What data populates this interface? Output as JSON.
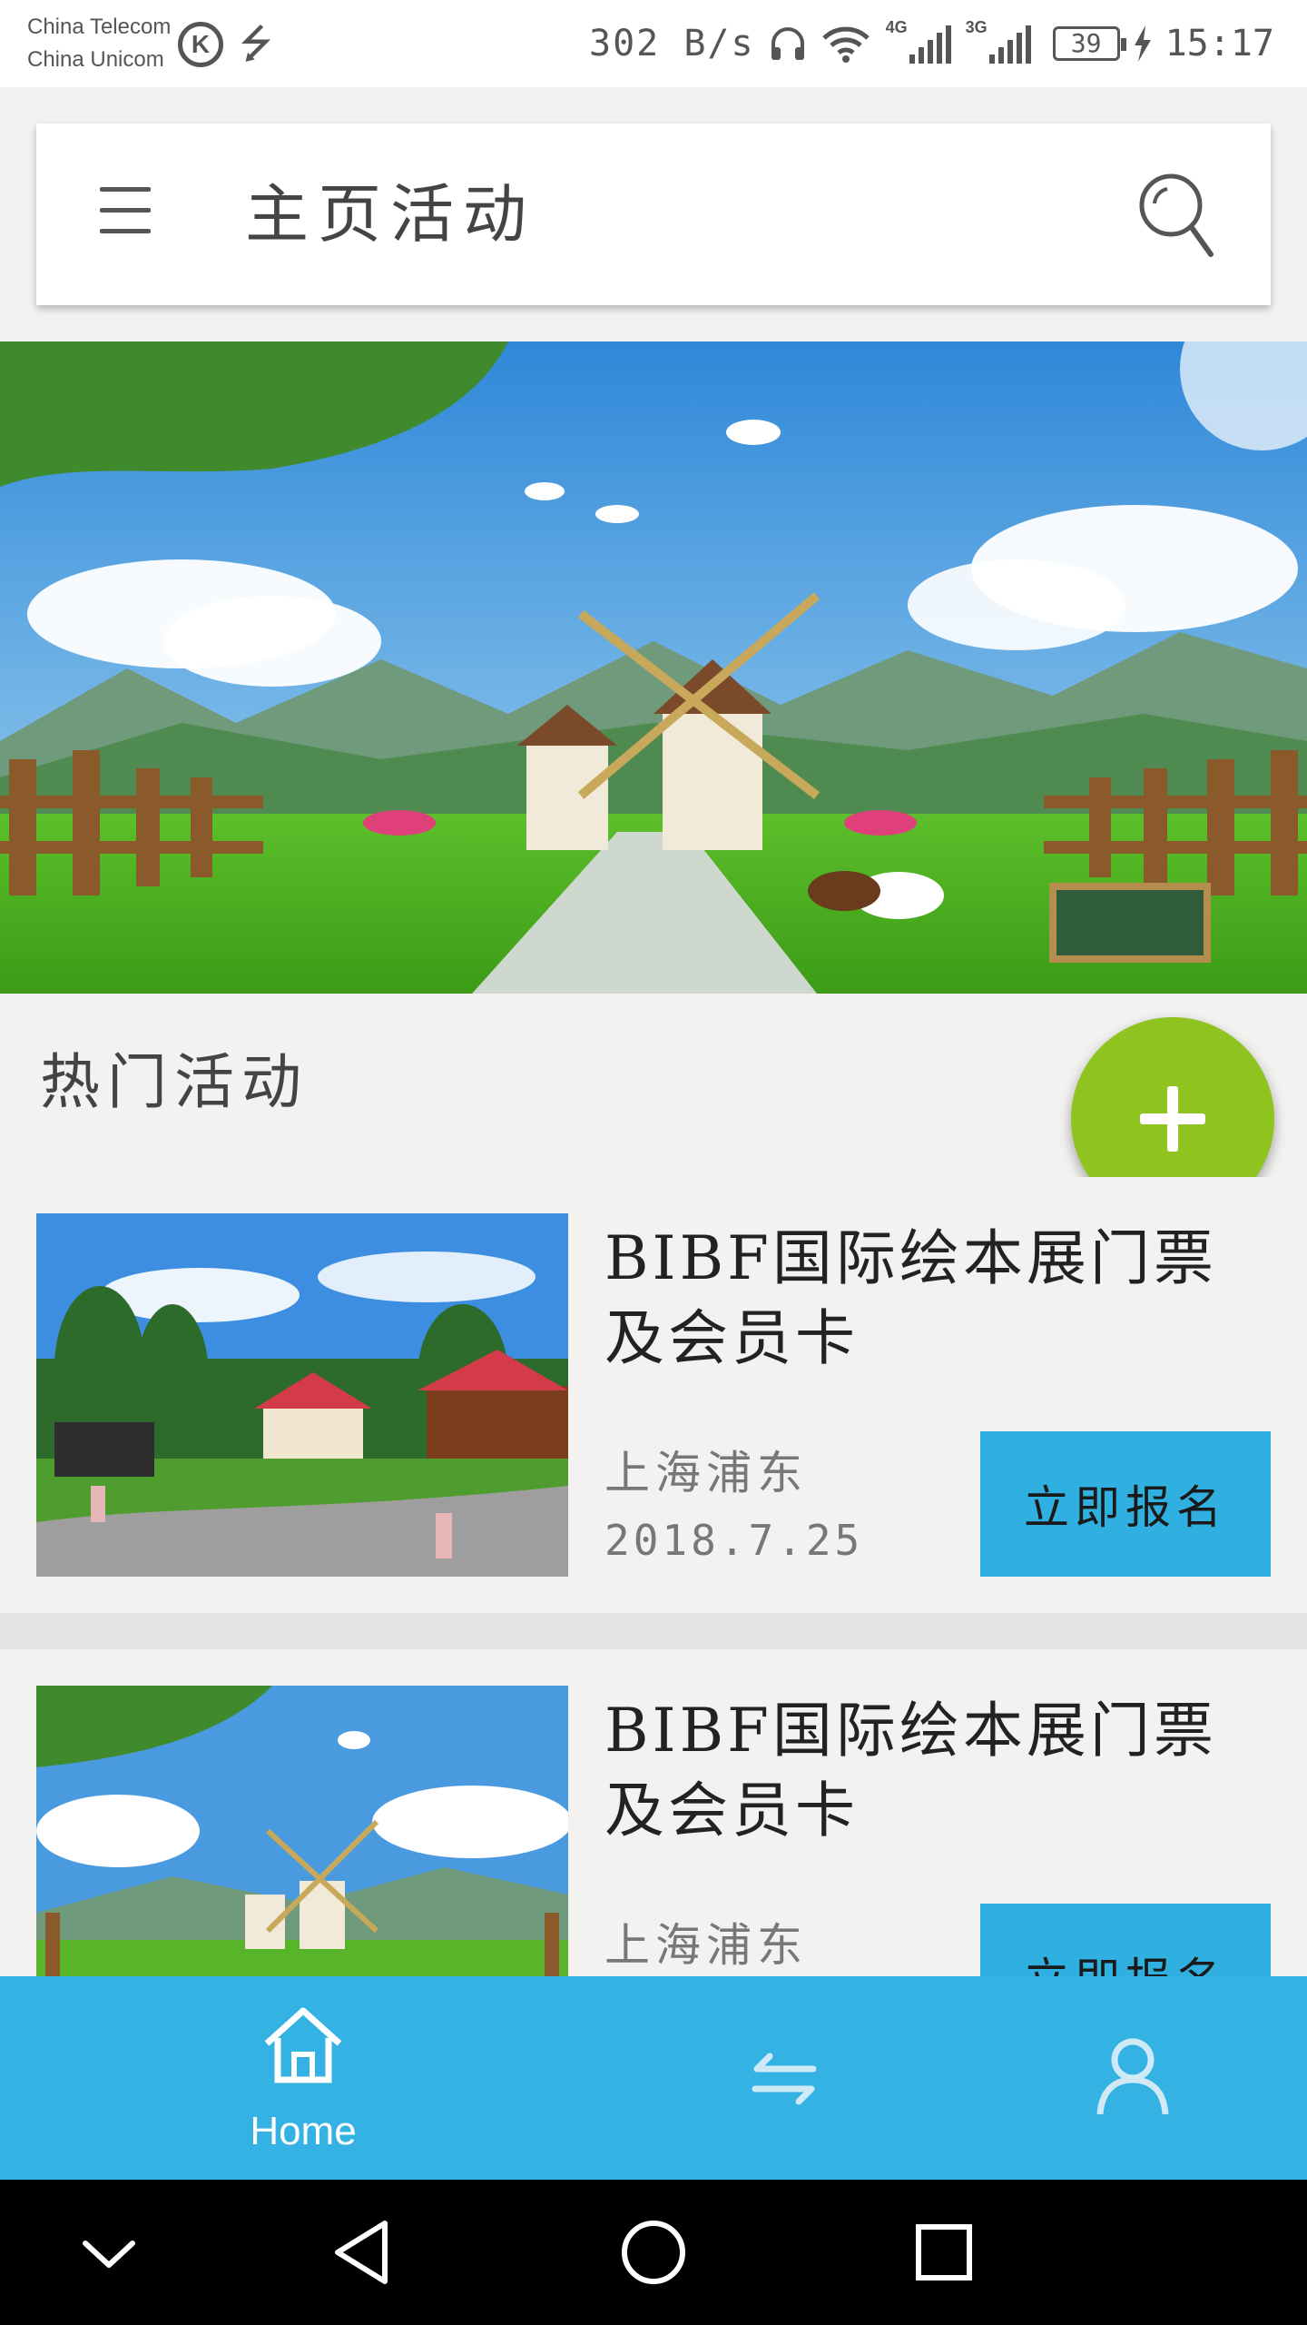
{
  "status_bar": {
    "carrier_1": "China Telecom",
    "carrier_2": "China Unicom",
    "speed": "302 B/s",
    "signal_tag_1": "4G",
    "signal_tag_2": "3G",
    "battery": "39",
    "time": "15:17"
  },
  "app_bar": {
    "title": "主页活动",
    "menu_icon": "hamburger-menu-icon",
    "search_icon": "search-icon"
  },
  "section": {
    "title": "热门活动"
  },
  "activities": [
    {
      "title": "BIBF国际绘本展门票及会员卡",
      "location": "上海浦东",
      "date": "2018.7.25",
      "button": "立即报名"
    },
    {
      "title": "BIBF国际绘本展门票及会员卡",
      "location": "上海浦东",
      "button": "立即报名"
    }
  ],
  "bottom_nav": {
    "home_label": "Home",
    "home_icon": "home-icon",
    "exchange_icon": "exchange-icon",
    "profile_icon": "user-icon",
    "active": "Home"
  },
  "colors": {
    "accent_blue": "#33b2e3",
    "button_blue": "#30b0e0",
    "fab_green": "#8fc31f",
    "background": "#f3f2f1"
  }
}
